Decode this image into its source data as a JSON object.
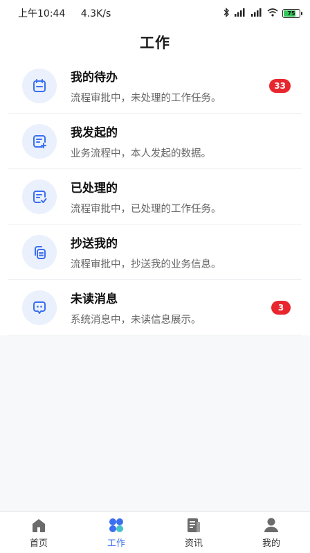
{
  "status_bar": {
    "time": "上午10:44",
    "net_speed": "4.3K/s",
    "battery": "75"
  },
  "header": {
    "title": "工作"
  },
  "items": [
    {
      "title": "我的待办",
      "desc": "流程审批中，未处理的工作任务。",
      "badge": "33",
      "icon": "calendar-icon"
    },
    {
      "title": "我发起的",
      "desc": "业务流程中，本人发起的数据。",
      "badge": "",
      "icon": "document-add-icon"
    },
    {
      "title": "已处理的",
      "desc": "流程审批中，已处理的工作任务。",
      "badge": "",
      "icon": "document-check-icon"
    },
    {
      "title": "抄送我的",
      "desc": "流程审批中，抄送我的业务信息。",
      "badge": "",
      "icon": "copy-icon"
    },
    {
      "title": "未读消息",
      "desc": "系统消息中，未读信息展示。",
      "badge": "3",
      "icon": "chat-icon"
    }
  ],
  "tabbar": [
    {
      "label": "首页",
      "icon": "home-icon",
      "active": false
    },
    {
      "label": "工作",
      "icon": "grid-icon",
      "active": true
    },
    {
      "label": "资讯",
      "icon": "news-icon",
      "active": false
    },
    {
      "label": "我的",
      "icon": "user-icon",
      "active": false
    }
  ],
  "colors": {
    "accent": "#3a6ff0",
    "badge": "#e8262e",
    "icon_bg": "#eaf0fc"
  }
}
